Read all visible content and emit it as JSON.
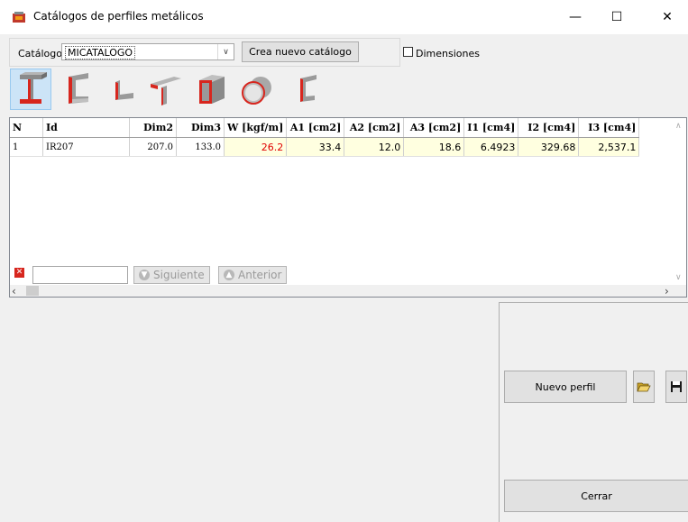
{
  "window": {
    "title": "Catálogos de perfiles metálicos",
    "minimize": "—",
    "maximize": "☐",
    "close": "✕"
  },
  "catalog": {
    "label": "Catálogo:",
    "value": "MICATALOGO",
    "new_button": "Crea nuevo catálogo",
    "dimensions_label": "Dimensiones"
  },
  "profile_types": [
    {
      "icon": "i-beam-icon",
      "selected": true
    },
    {
      "icon": "channel-icon"
    },
    {
      "icon": "angle-icon"
    },
    {
      "icon": "tee-icon"
    },
    {
      "icon": "box-icon"
    },
    {
      "icon": "pipe-icon"
    },
    {
      "icon": "z-channel-icon"
    }
  ],
  "table": {
    "headers": [
      "N",
      "Id",
      "Dim2",
      "Dim3",
      "W [kgf/m]",
      "A1 [cm2]",
      "A2 [cm2]",
      "A3 [cm2]",
      "I1 [cm4]",
      "I2 [cm4]",
      "I3 [cm4]"
    ],
    "rows": [
      [
        "1",
        "IR207",
        "207.0",
        "133.0",
        "26.2",
        "33.4",
        "12.0",
        "18.6",
        "6.4923",
        "329.68",
        "2,537.1"
      ]
    ]
  },
  "search": {
    "next": "Siguiente",
    "previous": "Anterior"
  },
  "actions": {
    "new_profile": "Nuevo perfil",
    "close": "Cerrar"
  },
  "colors": {
    "selected_bg": "#cce4f7",
    "calc_bg": "#ffffe0",
    "weight_color": "#e00000",
    "profile_red": "#d7261e"
  }
}
